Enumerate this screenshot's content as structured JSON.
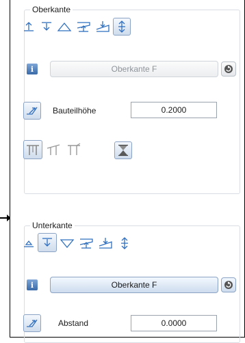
{
  "oberkante": {
    "title": "Oberkante",
    "reference": "Oberkante F",
    "height_label": "Bauteilhöhe",
    "height_value": "0.2000"
  },
  "unterkante": {
    "title": "Unterkante",
    "reference": "Oberkante F",
    "distance_label": "Abstand",
    "distance_value": "0.0000"
  },
  "icons": {
    "info": "i"
  },
  "colors": {
    "accent": "#2f6fbf",
    "active_fill": "#cfdcec",
    "disabled_text": "#8e949a"
  }
}
